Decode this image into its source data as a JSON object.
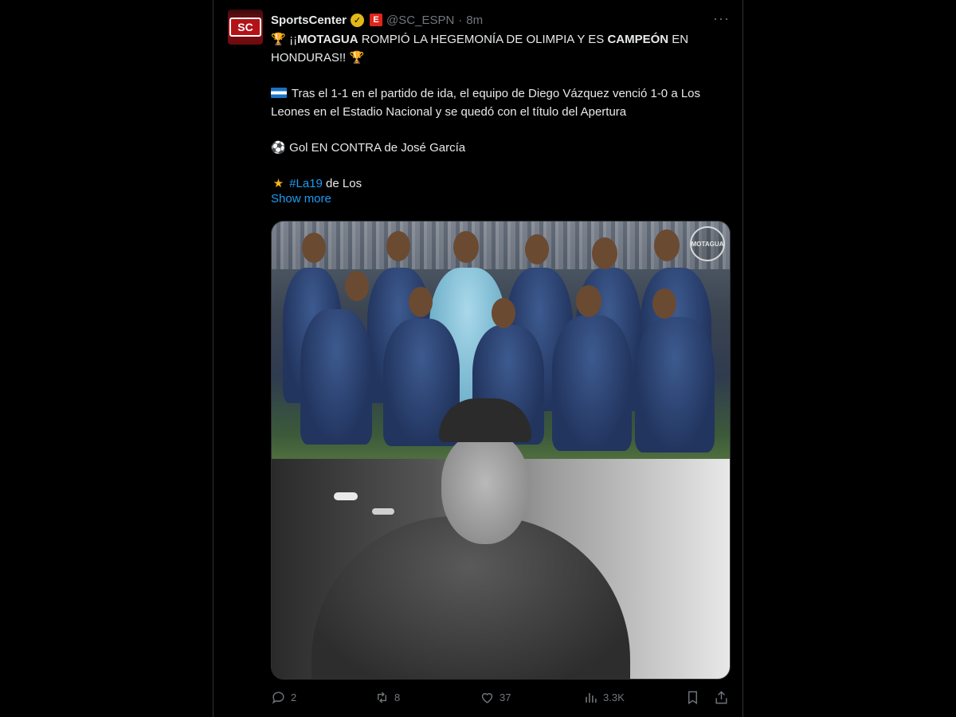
{
  "account": {
    "display_name": "SportsCenter",
    "handle": "@SC_ESPN",
    "separator": "·",
    "time": "8m",
    "avatar_text": "SC",
    "verified_icon": "verified-badge-icon",
    "affiliate_icon": "espn-affiliate-icon",
    "affiliate_text": "E"
  },
  "tweet": {
    "line1_emoji": "🏆",
    "line1_part1": "¡¡",
    "line1_bold1": "MOTAGUA",
    "line1_part2": " ROMPIÓ LA HEGEMONÍA DE OLIMPIA Y ES ",
    "line1_bold2": "CAMPEÓN",
    "line1_part3": " EN HONDURAS!! ",
    "line1_emoji_end": "🏆",
    "p2": "Tras el 1-1 en el partido de ida, el equipo de Diego Vázquez venció 1-0 a Los Leones en el Estadio Nacional y se quedó con el título del Apertura",
    "p3_emoji": "⚽",
    "p3": "Gol EN CONTRA de José García",
    "p4_emoji": "★",
    "p4_hashtag": "#La19",
    "p4_rest": " de Los",
    "show_more": "Show more"
  },
  "media": {
    "badge_text": "MOTAGUA"
  },
  "actions": {
    "replies": "2",
    "reposts": "8",
    "likes": "37",
    "views": "3.3K"
  },
  "colors": {
    "background": "#000000",
    "text": "#e7e9ea",
    "muted": "#71767b",
    "link": "#1d9bf0",
    "border": "#2f3336"
  }
}
